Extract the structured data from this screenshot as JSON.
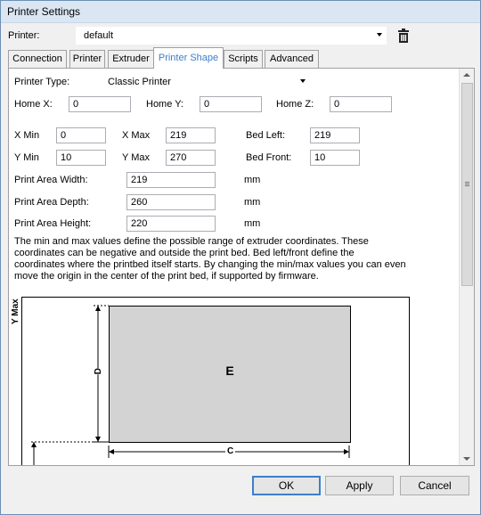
{
  "window": {
    "title": "Printer Settings"
  },
  "printer": {
    "label": "Printer:",
    "value": "default"
  },
  "tabs": [
    "Connection",
    "Printer",
    "Extruder",
    "Printer Shape",
    "Scripts",
    "Advanced"
  ],
  "active_tab": "Printer Shape",
  "shape": {
    "printer_type_label": "Printer Type:",
    "printer_type_value": "Classic Printer",
    "home_x_label": "Home X:",
    "home_x": "0",
    "home_y_label": "Home Y:",
    "home_y": "0",
    "home_z_label": "Home Z:",
    "home_z": "0",
    "x_min_label": "X Min",
    "x_min": "0",
    "x_max_label": "X Max",
    "x_max": "219",
    "bed_left_label": "Bed Left:",
    "bed_left": "219",
    "y_min_label": "Y Min",
    "y_min": "10",
    "y_max_label": "Y Max",
    "y_max": "270",
    "bed_front_label": "Bed Front:",
    "bed_front": "10",
    "width_label": "Print Area Width:",
    "width": "219",
    "width_unit": "mm",
    "depth_label": "Print Area Depth:",
    "depth": "260",
    "depth_unit": "mm",
    "height_label": "Print Area Height:",
    "height": "220",
    "height_unit": "mm",
    "description": "The min and max values define the possible range of extruder coordinates. These coordinates can be negative and outside the print bed. Bed left/front define the coordinates where the printbed itself starts. By changing the min/max values you can even move the origin in the center of the print bed, if supported by firmware."
  },
  "diagram": {
    "y_axis_label": "Y Max",
    "bed_label": "E",
    "depth_marker": "D",
    "width_marker": "C"
  },
  "buttons": {
    "ok": "OK",
    "apply": "Apply",
    "cancel": "Cancel"
  },
  "colors": {
    "accent": "#3c7fc9",
    "bed_fill": "#d3d3d3"
  },
  "icons": {
    "delete": "trash-icon"
  }
}
